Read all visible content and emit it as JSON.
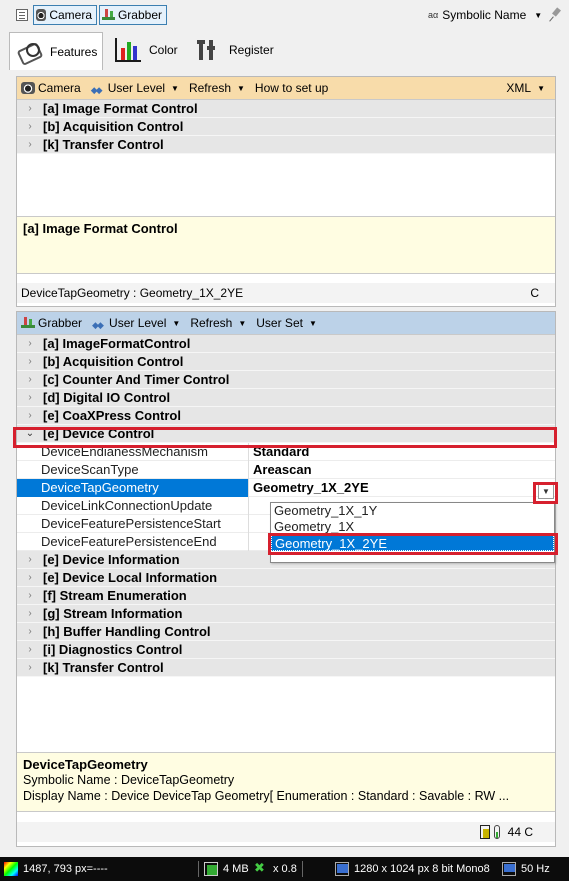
{
  "topbar": {
    "camera_label": "Camera",
    "grabber_label": "Grabber",
    "symbolic_name": "Symbolic Name",
    "aa_label": "aα"
  },
  "tabs": [
    {
      "label": "Features",
      "icon": "features-icon",
      "active": true
    },
    {
      "label": "Color",
      "icon": "color-chart-icon",
      "active": false
    },
    {
      "label": "Register",
      "icon": "register-icon",
      "active": false
    }
  ],
  "camera_pane": {
    "toolbar": {
      "camera": "Camera",
      "user_level": "User Level",
      "refresh": "Refresh",
      "how_to": "How to set up",
      "xml": "XML"
    },
    "groups": [
      "[a] Image Format Control",
      "[b] Acquisition Control",
      "[k] Transfer Control"
    ],
    "description": "[a] Image Format Control",
    "status_text": "DeviceTapGeometry : Geometry_1X_2YE",
    "status_right": "C"
  },
  "grabber_pane": {
    "toolbar": {
      "grabber": "Grabber",
      "user_level": "User Level",
      "refresh": "Refresh",
      "user_set": "User Set"
    },
    "groups_before": [
      "[a] ImageFormatControl",
      "[b] Acquisition Control",
      "[c] Counter And Timer Control",
      "[d] Digital IO Control",
      "[e] CoaXPress Control"
    ],
    "expanded_group": "[e] Device Control",
    "children": [
      {
        "name": "DeviceEndianessMechanism",
        "value": "Standard"
      },
      {
        "name": "DeviceScanType",
        "value": "Areascan"
      },
      {
        "name": "DeviceTapGeometry",
        "value": "Geometry_1X_2YE"
      },
      {
        "name": "DeviceLinkConnectionUpdate",
        "value": ""
      },
      {
        "name": "DeviceFeaturePersistenceStart",
        "value": ""
      },
      {
        "name": "DeviceFeaturePersistenceEnd",
        "value": ""
      }
    ],
    "dropdown_options": [
      "Geometry_1X_1Y",
      "Geometry_1X",
      "Geometry_1X_2YE"
    ],
    "groups_after": [
      "[e] Device Information",
      "[e] Device Local Information",
      "[f] Stream Enumeration",
      "[g] Stream Information",
      "[h] Buffer Handling Control",
      "[i] Diagnostics Control",
      "[k] Transfer Control"
    ],
    "description": {
      "title": "DeviceTapGeometry",
      "symbolic": "Symbolic Name : DeviceTapGeometry",
      "display": "Display  Name : Device DeviceTap Geometry[ Enumeration : Standard : Savable : RW ..."
    },
    "status_temp": "44 C"
  },
  "statusbar": {
    "coords": "1487, 793 px=----",
    "memory": "4 MB",
    "zoom": "x 0.8",
    "image_info": "1280 x 1024 px 8 bit Mono8",
    "refresh_rate": "50 Hz"
  },
  "colors": {
    "camera_bar": "#f8dcaa",
    "grabber_bar": "#bcd2e8",
    "selection": "#0078d7",
    "description_bg": "#fffde2",
    "highlight": "#d6202e"
  }
}
